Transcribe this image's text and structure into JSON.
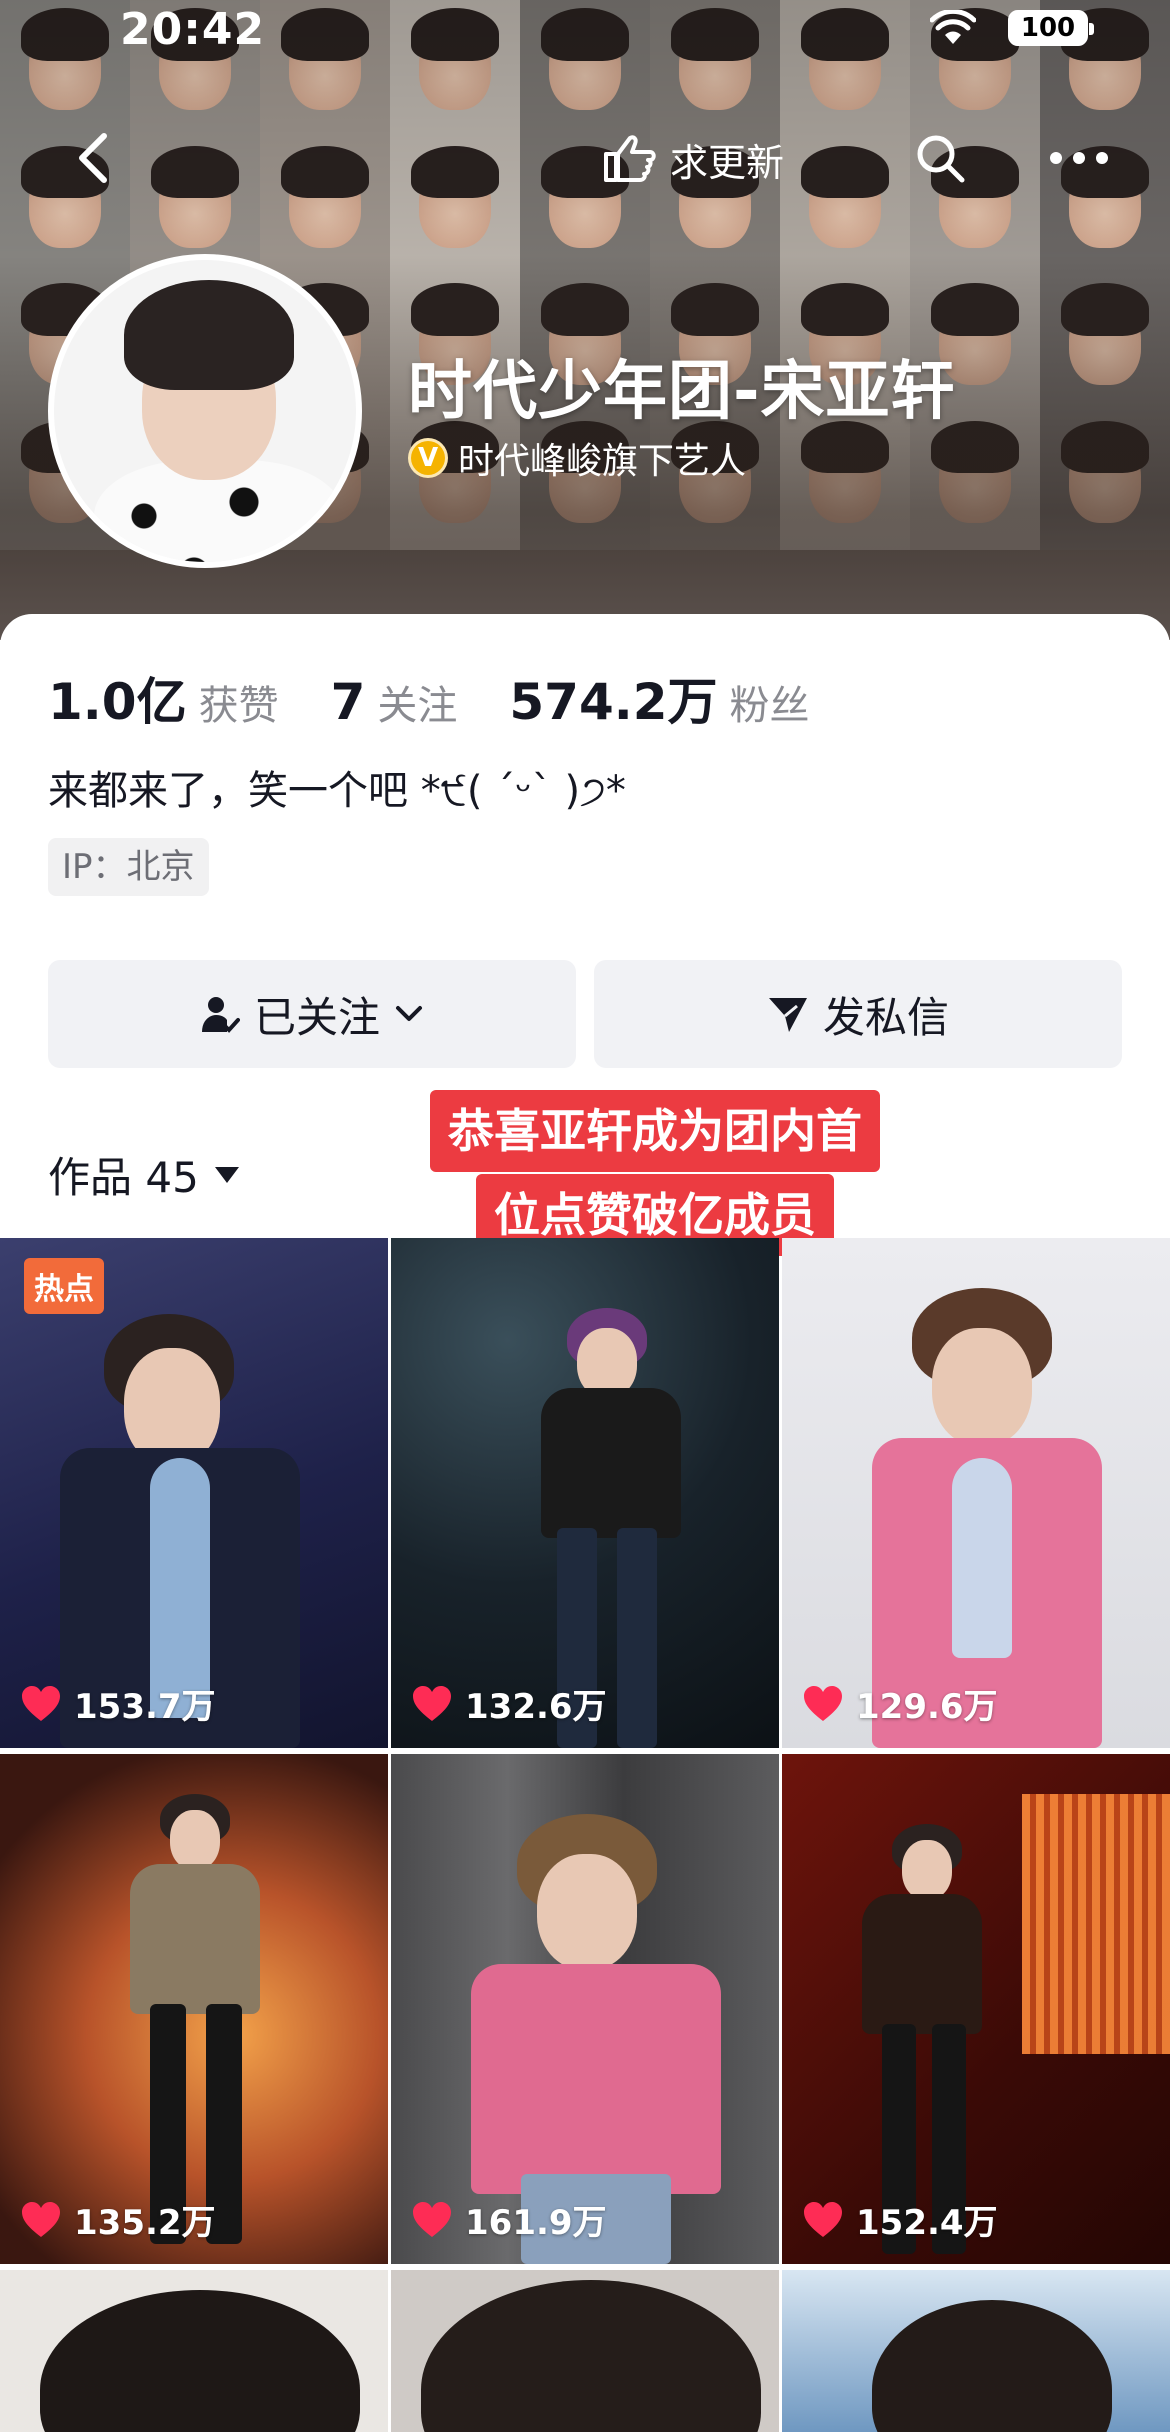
{
  "status_bar": {
    "time": "20:42",
    "battery": "100"
  },
  "nav": {
    "update_request_label": "求更新"
  },
  "profile": {
    "name": "时代少年团-宋亚轩",
    "verified_label": "时代峰峻旗下艺人",
    "verify_badge": "V",
    "stats": [
      {
        "number": "1.0亿",
        "label": "获赞"
      },
      {
        "number": "7",
        "label": "关注"
      },
      {
        "number": "574.2万",
        "label": "粉丝"
      }
    ],
    "bio": "来都来了，笑一个吧 *੯( ˊᵕˋ )੭*",
    "ip": "IP：北京"
  },
  "actions": {
    "follow_label": "已关注",
    "message_label": "发私信"
  },
  "works": {
    "label": "作品 45"
  },
  "overlay_caption": {
    "line1": "恭喜亚轩成为团内首",
    "line2": "位点赞破亿成员"
  },
  "videos": [
    {
      "likes": "153.7万",
      "badge": "热点"
    },
    {
      "likes": "132.6万"
    },
    {
      "likes": "129.6万"
    },
    {
      "likes": "135.2万"
    },
    {
      "likes": "161.9万"
    },
    {
      "likes": "152.4万"
    }
  ],
  "colors": {
    "accent_red": "#ec3b41",
    "hot_badge": "#f26b3a",
    "like_heart": "#fe2c55",
    "verify_gold": "#f5b301"
  }
}
